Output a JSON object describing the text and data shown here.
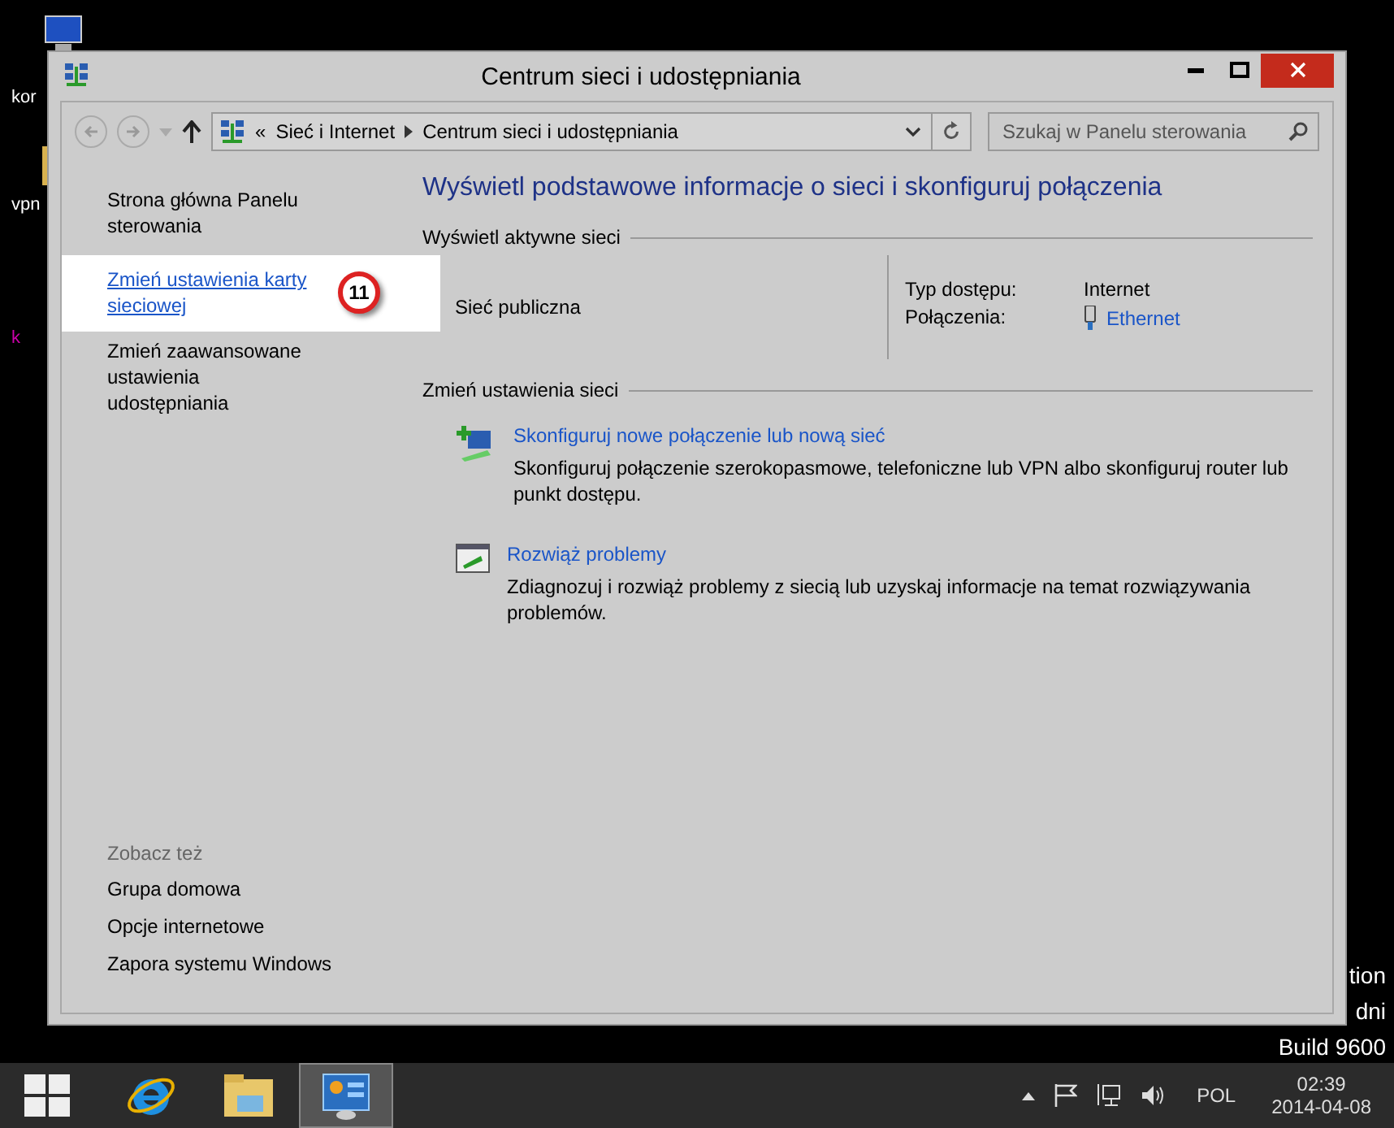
{
  "desktop": {
    "icons": [
      {
        "label": "kor"
      },
      {
        "label": "vpn"
      },
      {
        "label": "k"
      }
    ],
    "watermark_lines": [
      "tion",
      "dni",
      "Build 9600"
    ]
  },
  "window": {
    "title": "Centrum sieci i udostępniania"
  },
  "address_bar": {
    "overflow": "«",
    "crumbs": [
      "Sieć i Internet",
      "Centrum sieci i udostępniania"
    ]
  },
  "search": {
    "placeholder": "Szukaj w Panelu sterowania"
  },
  "sidebar": {
    "items": [
      {
        "label": "Strona główna Panelu sterowania",
        "selected": false
      },
      {
        "label": "Zmień ustawienia karty sieciowej",
        "selected": true,
        "badge": "11"
      },
      {
        "label": "Zmień zaawansowane ustawienia udostępniania",
        "selected": false
      }
    ],
    "see_also": {
      "heading": "Zobacz też",
      "items": [
        "Grupa domowa",
        "Opcje internetowe",
        "Zapora systemu Windows"
      ]
    }
  },
  "main": {
    "heading": "Wyświetl podstawowe informacje o sieci i skonfiguruj połączenia",
    "active_networks": {
      "heading": "Wyświetl aktywne sieci",
      "network_name": "Sieć publiczna",
      "access_type_label": "Typ dostępu:",
      "access_type": "Internet",
      "connections_label": "Połączenia:",
      "connection": "Ethernet"
    },
    "change_settings": {
      "heading": "Zmień ustawienia sieci",
      "tasks": [
        {
          "kind": "new-connection",
          "link": "Skonfiguruj nowe połączenie lub nową sieć",
          "description": "Skonfiguruj połączenie szerokopasmowe, telefoniczne lub VPN albo skonfiguruj router lub punkt dostępu."
        },
        {
          "kind": "troubleshoot",
          "link": "Rozwiąż problemy",
          "description": "Zdiagnozuj i rozwiąż problemy z siecią lub uzyskaj informacje na temat rozwiązywania problemów."
        }
      ]
    }
  },
  "taskbar": {
    "apps": [
      {
        "kind": "ie",
        "selected": false
      },
      {
        "kind": "explorer",
        "selected": false
      },
      {
        "kind": "control-panel",
        "selected": true
      }
    ],
    "language": "POL",
    "time": "02:39",
    "date": "2014-04-08"
  }
}
